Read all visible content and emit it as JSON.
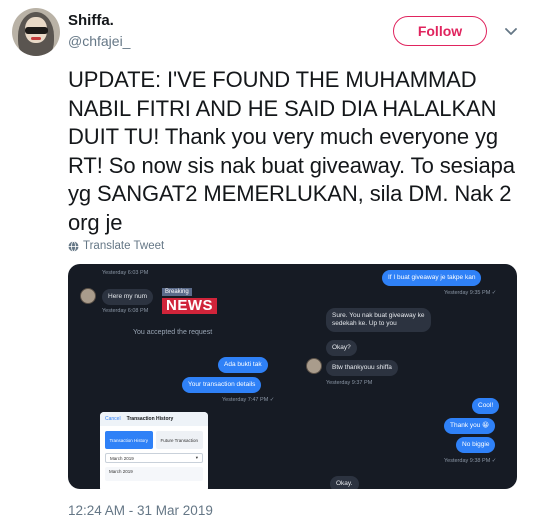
{
  "user": {
    "name": "Shiffa.",
    "handle": "@chfajei_"
  },
  "follow_label": "Follow",
  "tweet": {
    "text": "UPDATE: I'VE FOUND THE MUHAMMAD NABIL FITRI AND HE SAID DIA HALALKAN DUIT TU! Thank you very much everyone yg RT! So now sis nak buat giveaway. To sesiapa yg SANGAT2 MEMERLUKAN, sila DM. Nak 2 org je",
    "translate_label": "Translate Tweet",
    "timestamp": "12:24 AM - 31 Mar 2019"
  },
  "colors": {
    "accent": "#e0245e",
    "secondary_text": "#657786",
    "chat_bg": "#161b24",
    "bubble_out": "#2f81f7",
    "bubble_in": "#2c3340"
  },
  "chat_left": {
    "ts1": "Yesterday 6:03 PM",
    "msg_here": "Here my num",
    "news_small": "Breaking",
    "news_big": "NEWS",
    "ts2": "Yesterday 6:08 PM",
    "accepted": "You accepted the request",
    "msg_bukti": "Ada bukti tak",
    "msg_details": "Your transaction details",
    "ts3": "Yesterday 7:47 PM ✓"
  },
  "chat_right": {
    "msg_giveaway": "If I buat giveaway je takpe kan",
    "ts1": "Yesterday 9:35 PM ✓",
    "msg_sure": "Sure. You nak buat giveaway ke\nsedekah ke. Up to you",
    "msg_okay": "Okay?",
    "msg_btw": "Btw thankyouu shiffa",
    "ts2": "Yesterday 9:37 PM",
    "msg_cool": "Cool!",
    "msg_thank": "Thank you 😀",
    "msg_biggie": "No biggie",
    "ts3": "Yesterday 9:38 PM ✓",
    "msg_okay2": "Okay."
  },
  "transaction_card": {
    "cancel": "Cancel",
    "title": "Transaction History",
    "tab_history": "Transaction History",
    "tab_future": "Future Transaction",
    "month": "March 2019",
    "row": "March 2019"
  }
}
